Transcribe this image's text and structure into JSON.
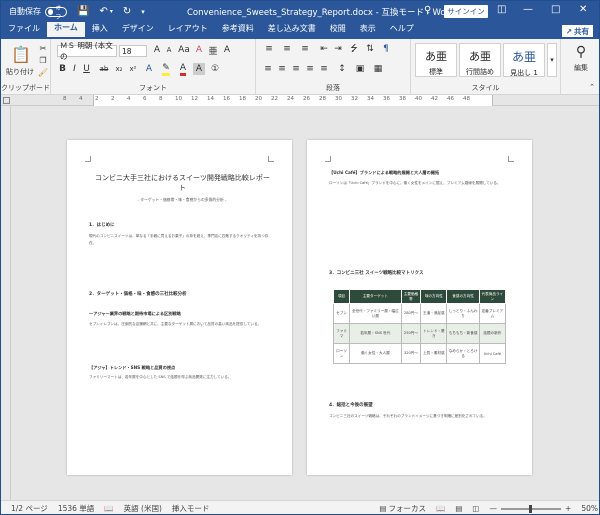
{
  "titlebar": {
    "autosave_label": "自動保存",
    "autosave_state": "オフ",
    "doc_title": "Convenience_Sweets_Strategy_Report.docx",
    "compat_mode": "互換モード",
    "app_name": "Word",
    "signin_label": "サインイン"
  },
  "tabs": [
    "ファイル",
    "ホーム",
    "挿入",
    "デザイン",
    "レイアウト",
    "参考資料",
    "差し込み文書",
    "校閲",
    "表示",
    "ヘルプ"
  ],
  "active_tab": "ホーム",
  "share_label": "共有",
  "ribbon": {
    "clipboard": {
      "paste_label": "貼り付け",
      "group_label": "クリップボード"
    },
    "font": {
      "font_name": "ＭＳ 明朝 (本文の",
      "font_size": "18",
      "group_label": "フォント",
      "bold": "B",
      "italic": "I",
      "underline": "U",
      "strike": "ab",
      "sub": "x₂",
      "sup": "x²",
      "font_color_letter": "A",
      "aa": "Aa",
      "grow": "A",
      "ruby": "亜"
    },
    "paragraph": {
      "group_label": "段落"
    },
    "styles": {
      "group_label": "スタイル",
      "items": [
        {
          "sample": "あ亜",
          "name": "標準"
        },
        {
          "sample": "あ亜",
          "name": "行間詰め"
        },
        {
          "sample": "あ亜",
          "name": "見出し 1"
        }
      ]
    },
    "editing": {
      "label": "編集"
    }
  },
  "ruler_labels": [
    "8",
    "4",
    "2",
    "2",
    "4",
    "6",
    "8",
    "10",
    "12",
    "14",
    "16",
    "18",
    "20",
    "22",
    "24",
    "26",
    "28",
    "30",
    "32",
    "34",
    "36",
    "38",
    "40",
    "42",
    "46",
    "48"
  ],
  "page1": {
    "title": "コンビニ大手三社におけるスイーツ開発戦略比較レポート",
    "subtitle": "- ターゲット・価格帯・味・食感からの多角的分析 -",
    "h1": "1．はじめに",
    "h2": "2．ターゲット・価格・味・食感の三社比較分析",
    "h2a": "～アジャ～業界の戦略と期待市場による区別戦略",
    "h2b": "【アジャ】トレンド・SNS 戦略と品質の視点",
    "body1": "現代のコンビニスイーツは、単なる「手軽に買えるお菓子」の枠を超え、専門店に匹敵するクオリティを持つ存在。",
    "body2": "セブンイレブンは、圧倒的な店舗網と共に、主要なターゲット層において品質の高い商品を提供している。",
    "body3": "ファミリーマートは、若年層を中心とした SNS で話題を呼ぶ商品開発に注力している。"
  },
  "page2": {
    "h_brand": "【Uchi Café】ブランドによる戦略的展開と大人層の開拓",
    "body_a": "ローソンは「Uchi Café」ブランドを中心に、働く女性をメインに据え、プレミアム路線を展開している。",
    "h3": "3．コンビニ三社 スイーツ戦略比較マトリクス",
    "table_headers": [
      "項目",
      "主要ターゲット",
      "主要価格帯",
      "味の方向性",
      "食感の方向性",
      "代表商品ライン"
    ],
    "table_rows": [
      [
        "セブン",
        "全世代・ファミリー層・幅広い層",
        "280円〜",
        "王道・満足感",
        "しっとり・ふんわり",
        "定番プレミアム"
      ],
      [
        "ファミマ",
        "若年層・SNS 世代",
        "250円〜",
        "トレンド・驚き",
        "もちもち・新食感",
        "話題の新作"
      ],
      [
        "ローソン",
        "働く女性・大人層",
        "320円〜",
        "上質・素材感",
        "なめらか・とろける",
        "Uchi Café"
      ]
    ],
    "h4": "4．総括と今後の展望",
    "body_b": "コンビニ三社のスイーツ戦略は、それぞれのブランドイメージに基づき明確に差別化されている。"
  },
  "status": {
    "page": "1/2 ページ",
    "words": "1536 単語",
    "lang": "英語 (米国)",
    "mode": "挿入モード",
    "focus": "フォーカス",
    "zoom": "50%"
  }
}
